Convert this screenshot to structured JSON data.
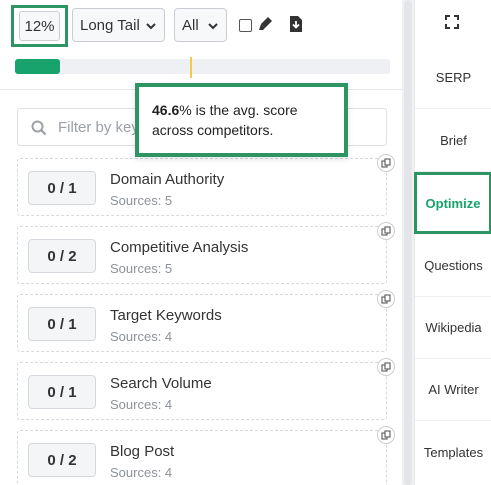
{
  "toolbar": {
    "score": "12%",
    "filter_select": "Long Tail",
    "scope_select": "All",
    "icons": [
      "checkbox",
      "highlighter-icon",
      "download-icon"
    ]
  },
  "progress": {
    "fill_percent": 12,
    "avg_marker_percent": 46.6,
    "fill_color": "#17a36b",
    "marker_color": "#f2c94c"
  },
  "tooltip": {
    "value": "46.6",
    "text_after_value": "% is the avg. score",
    "line2": "across competitors."
  },
  "search": {
    "placeholder": "Filter by key"
  },
  "topics": [
    {
      "count": "0 / 1",
      "name": "Domain Authority",
      "sources": "Sources: 5"
    },
    {
      "count": "0 / 2",
      "name": "Competitive Analysis",
      "sources": "Sources: 5"
    },
    {
      "count": "0 / 1",
      "name": "Target Keywords",
      "sources": "Sources: 4"
    },
    {
      "count": "0 / 1",
      "name": "Search Volume",
      "sources": "Sources: 4"
    },
    {
      "count": "0 / 2",
      "name": "Blog Post",
      "sources": "Sources: 4"
    }
  ],
  "sidebar": {
    "items": [
      {
        "label": "SERP"
      },
      {
        "label": "Brief"
      },
      {
        "label": "Optimize"
      },
      {
        "label": "Questions"
      },
      {
        "label": "Wikipedia"
      },
      {
        "label": "AI Writer"
      },
      {
        "label": "Templates"
      }
    ],
    "active": "Optimize",
    "accent_color": "#2e9463"
  }
}
